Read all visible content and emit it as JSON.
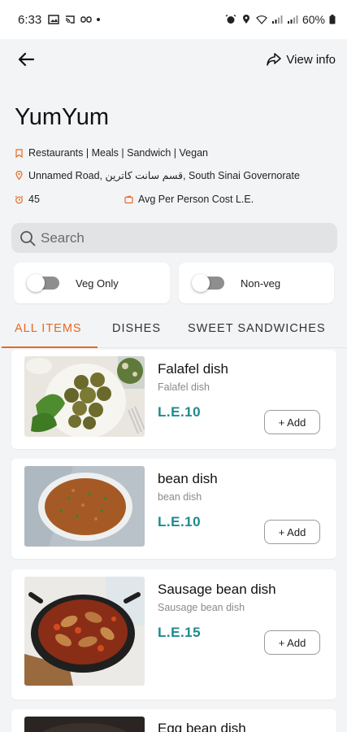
{
  "status_bar": {
    "time": "6:33",
    "battery": "60%"
  },
  "header": {
    "view_info_label": "View info"
  },
  "restaurant": {
    "name": "YumYum",
    "categories": "Restaurants | Meals | Sandwich | Vegan",
    "address": "Unnamed Road, قسم سانت كاترين, South Sinai Governorate",
    "time_value": "45",
    "cost_label": "Avg Per Person Cost L.E."
  },
  "search": {
    "placeholder": "Search"
  },
  "filters": {
    "veg_label": "Veg Only",
    "nonveg_label": "Non-veg"
  },
  "tabs": [
    {
      "label": "ALL ITEMS"
    },
    {
      "label": "DISHES"
    },
    {
      "label": "SWEET SANDWICHES"
    }
  ],
  "items": [
    {
      "name": "Falafel dish",
      "description": "Falafel dish",
      "price": "L.E.10",
      "add_label": "+ Add"
    },
    {
      "name": "bean dish",
      "description": "bean dish",
      "price": "L.E.10",
      "add_label": "+ Add"
    },
    {
      "name": "Sausage bean dish",
      "description": "Sausage bean dish",
      "price": "L.E.15",
      "add_label": "+ Add"
    },
    {
      "name": "Egg bean dish"
    }
  ],
  "colors": {
    "accent": "#e46a22",
    "price": "#1c8a8e",
    "background": "#f3f4f6"
  }
}
